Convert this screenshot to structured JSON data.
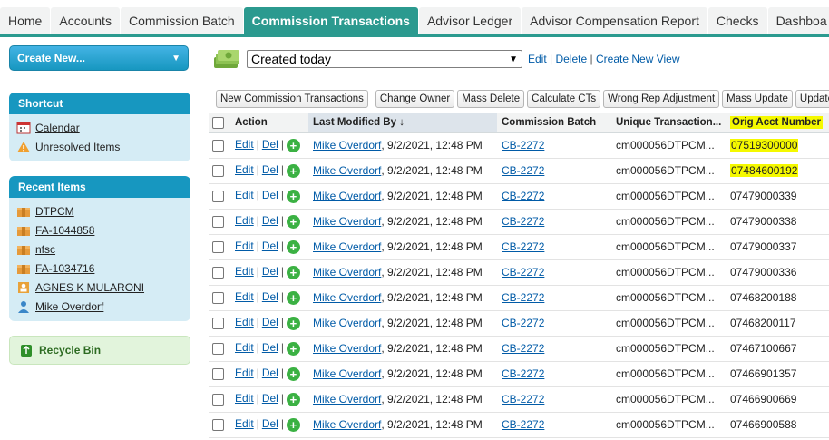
{
  "tabs": [
    {
      "label": "Home",
      "active": false
    },
    {
      "label": "Accounts",
      "active": false
    },
    {
      "label": "Commission Batch",
      "active": false
    },
    {
      "label": "Commission Transactions",
      "active": true
    },
    {
      "label": "Advisor Ledger",
      "active": false
    },
    {
      "label": "Advisor Compensation Report",
      "active": false
    },
    {
      "label": "Checks",
      "active": false
    },
    {
      "label": "Dashboa",
      "active": false
    }
  ],
  "sidebar": {
    "create_new": "Create New...",
    "shortcut": {
      "title": "Shortcut",
      "items": [
        {
          "label": "Calendar",
          "icon": "calendar-icon"
        },
        {
          "label": "Unresolved Items",
          "icon": "warning-icon"
        }
      ]
    },
    "recent": {
      "title": "Recent Items",
      "items": [
        {
          "label": "DTPCM",
          "icon": "box-icon"
        },
        {
          "label": "FA-1044858",
          "icon": "box-icon"
        },
        {
          "label": "nfsc",
          "icon": "box-icon"
        },
        {
          "label": "FA-1034716",
          "icon": "box-icon"
        },
        {
          "label": "AGNES K MULARONI",
          "icon": "contact-card-icon"
        },
        {
          "label": "Mike Overdorf",
          "icon": "user-icon"
        }
      ]
    },
    "recycle_bin": "Recycle Bin"
  },
  "view": {
    "selected": "Created today",
    "edit": "Edit",
    "delete": "Delete",
    "create_new_view": "Create New View",
    "sep": "|"
  },
  "buttons": [
    "New Commission Transactions",
    "Change Owner",
    "Mass Delete",
    "Calculate CTs",
    "Wrong Rep Adjustment",
    "Mass Update",
    "Update FA"
  ],
  "table": {
    "columns": {
      "action": "Action",
      "modified": "Last Modified By",
      "sort_arrow": "↓",
      "batch": "Commission Batch",
      "unique": "Unique Transaction...",
      "orig": "Orig Acct Number"
    },
    "action_labels": {
      "edit": "Edit",
      "del": "Del",
      "sep": "|",
      "add": "+"
    },
    "rows": [
      {
        "modified_by": "Mike Overdorf",
        "modified_at": ", 9/2/2021, 12:48 PM",
        "batch": "CB-2272",
        "unique": "cm000056DTPCM...",
        "orig": "07519300000",
        "highlight": true
      },
      {
        "modified_by": "Mike Overdorf",
        "modified_at": ", 9/2/2021, 12:48 PM",
        "batch": "CB-2272",
        "unique": "cm000056DTPCM...",
        "orig": "07484600192",
        "highlight": true
      },
      {
        "modified_by": "Mike Overdorf",
        "modified_at": ", 9/2/2021, 12:48 PM",
        "batch": "CB-2272",
        "unique": "cm000056DTPCM...",
        "orig": "07479000339",
        "highlight": false
      },
      {
        "modified_by": "Mike Overdorf",
        "modified_at": ", 9/2/2021, 12:48 PM",
        "batch": "CB-2272",
        "unique": "cm000056DTPCM...",
        "orig": "07479000338",
        "highlight": false
      },
      {
        "modified_by": "Mike Overdorf",
        "modified_at": ", 9/2/2021, 12:48 PM",
        "batch": "CB-2272",
        "unique": "cm000056DTPCM...",
        "orig": "07479000337",
        "highlight": false
      },
      {
        "modified_by": "Mike Overdorf",
        "modified_at": ", 9/2/2021, 12:48 PM",
        "batch": "CB-2272",
        "unique": "cm000056DTPCM...",
        "orig": "07479000336",
        "highlight": false
      },
      {
        "modified_by": "Mike Overdorf",
        "modified_at": ", 9/2/2021, 12:48 PM",
        "batch": "CB-2272",
        "unique": "cm000056DTPCM...",
        "orig": "07468200188",
        "highlight": false
      },
      {
        "modified_by": "Mike Overdorf",
        "modified_at": ", 9/2/2021, 12:48 PM",
        "batch": "CB-2272",
        "unique": "cm000056DTPCM...",
        "orig": "07468200117",
        "highlight": false
      },
      {
        "modified_by": "Mike Overdorf",
        "modified_at": ", 9/2/2021, 12:48 PM",
        "batch": "CB-2272",
        "unique": "cm000056DTPCM...",
        "orig": "07467100667",
        "highlight": false
      },
      {
        "modified_by": "Mike Overdorf",
        "modified_at": ", 9/2/2021, 12:48 PM",
        "batch": "CB-2272",
        "unique": "cm000056DTPCM...",
        "orig": "07466901357",
        "highlight": false
      },
      {
        "modified_by": "Mike Overdorf",
        "modified_at": ", 9/2/2021, 12:48 PM",
        "batch": "CB-2272",
        "unique": "cm000056DTPCM...",
        "orig": "07466900669",
        "highlight": false
      },
      {
        "modified_by": "Mike Overdorf",
        "modified_at": ", 9/2/2021, 12:48 PM",
        "batch": "CB-2272",
        "unique": "cm000056DTPCM...",
        "orig": "07466900588",
        "highlight": false
      }
    ]
  },
  "colors": {
    "tab_accent": "#2b9a8f",
    "sidebar_header": "#1797c0",
    "highlight": "#f5f900",
    "link": "#015ba7"
  }
}
